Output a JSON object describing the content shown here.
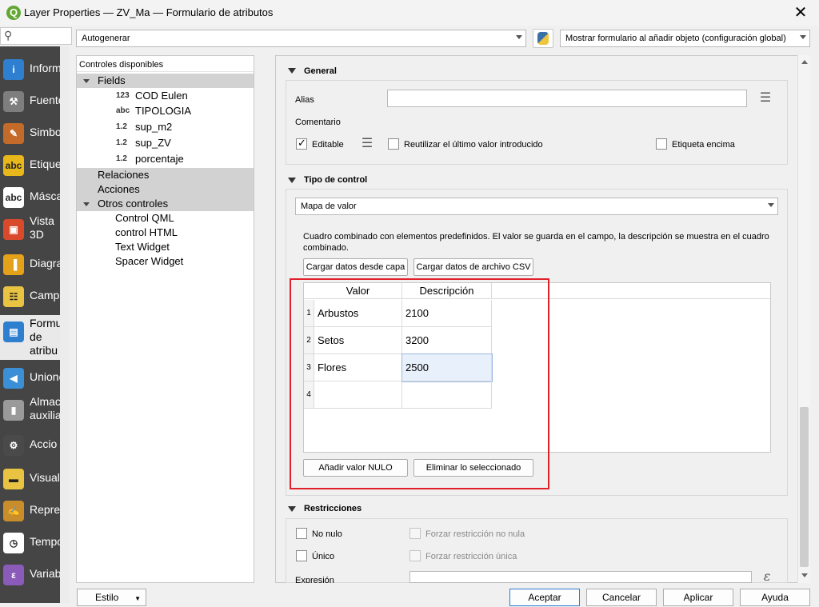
{
  "window": {
    "app_icon": "Q",
    "title": "Layer Properties — ZV_Ma — Formulario de atributos",
    "close_glyph": "✕"
  },
  "search": {
    "placeholder": ""
  },
  "sidebar": {
    "items": [
      {
        "label": "Inform",
        "icon": "info-icon",
        "color": "#2f7fd0",
        "glyph": "i"
      },
      {
        "label": "Fuente",
        "icon": "tools-icon",
        "color": "#7e7e7e",
        "glyph": "⚒"
      },
      {
        "label": "Simbo",
        "icon": "paint-icon",
        "color": "#c46b2a",
        "glyph": "✎"
      },
      {
        "label": "Etique",
        "icon": "abc-label-icon",
        "color": "#e8b71c",
        "glyph": "abc"
      },
      {
        "label": "Másca",
        "icon": "abc-mask-icon",
        "color": "#ffffff",
        "glyph": "abc"
      },
      {
        "label": "Vista 3D",
        "icon": "cube-3d-icon",
        "color": "#d94a2c",
        "glyph": "▣"
      },
      {
        "label": "Diagra",
        "icon": "diagram-icon",
        "color": "#e4a21a",
        "glyph": "▐"
      },
      {
        "label": "Campo",
        "icon": "fields-icon",
        "color": "#e9c342",
        "glyph": "☷"
      },
      {
        "label": "Formu de atribu",
        "icon": "form-icon",
        "color": "#2f7fd0",
        "glyph": "▤"
      },
      {
        "label": "Unione",
        "icon": "join-icon",
        "color": "#3b8fd6",
        "glyph": "◀"
      },
      {
        "label": "Almac auxilia",
        "icon": "database-icon",
        "color": "#9a9a9a",
        "glyph": "▮"
      },
      {
        "label": "Accio",
        "icon": "action-gear-icon",
        "color": "#4a4a4a",
        "glyph": "⚙"
      },
      {
        "label": "Visuali",
        "icon": "tooltip-icon",
        "color": "#e9c342",
        "glyph": "▬"
      },
      {
        "label": "Repres",
        "icon": "brush-icon",
        "color": "#c98d2b",
        "glyph": "✍"
      },
      {
        "label": "Tempo",
        "icon": "clock-icon",
        "color": "#ffffff",
        "glyph": "◷"
      },
      {
        "label": "Variab",
        "icon": "epsilon-icon",
        "color": "#8a5bb8",
        "glyph": "ε"
      }
    ]
  },
  "toolbar": {
    "layout_mode": "Autogenerar",
    "show_form_option": "Mostrar formulario al añadir objeto (configuración global)"
  },
  "controls_panel": {
    "header": "Controles disponibles",
    "tree": [
      {
        "label": "Fields",
        "kind": "group",
        "expanded": true
      },
      {
        "label": "COD Eulen",
        "type": "123",
        "kind": "field"
      },
      {
        "label": "TIPOLOGIA",
        "type": "abc",
        "kind": "field"
      },
      {
        "label": "sup_m2",
        "type": "1.2",
        "kind": "field"
      },
      {
        "label": "sup_ZV",
        "type": "1.2",
        "kind": "field"
      },
      {
        "label": "porcentaje",
        "type": "1.2",
        "kind": "field"
      },
      {
        "label": "Relaciones",
        "kind": "group"
      },
      {
        "label": "Acciones",
        "kind": "group"
      },
      {
        "label": "Otros controles",
        "kind": "group",
        "expanded": true
      },
      {
        "label": "Control QML",
        "kind": "child"
      },
      {
        "label": "control HTML",
        "kind": "child"
      },
      {
        "label": "Text Widget",
        "kind": "child"
      },
      {
        "label": "Spacer Widget",
        "kind": "child"
      }
    ]
  },
  "general": {
    "title": "General",
    "alias_label": "Alias",
    "alias_value": "",
    "comment_label": "Comentario",
    "editable_label": "Editable",
    "editable_checked": true,
    "reuse_label": "Reutilizar el último valor introducido",
    "reuse_checked": false,
    "label_on_top": "Etiqueta encima",
    "label_on_top_checked": false
  },
  "widget_type": {
    "title": "Tipo de control",
    "selected": "Mapa de valor",
    "description": "Cuadro combinado con elementos predefinidos. El valor se guarda en el campo, la descripción se muestra en el cuadro combinado.",
    "load_layer_button": "Cargar datos desde capa",
    "load_csv_button": "Cargar datos de archivo CSV",
    "table": {
      "columns": [
        "Valor",
        "Descripción"
      ],
      "rows": [
        {
          "num": "1",
          "valor": "Arbustos",
          "descripcion": "2100"
        },
        {
          "num": "2",
          "valor": "Setos",
          "descripcion": "3200"
        },
        {
          "num": "3",
          "valor": "Flores",
          "descripcion": "2500"
        },
        {
          "num": "4",
          "valor": "",
          "descripcion": ""
        }
      ]
    },
    "add_null_button": "Añadir valor NULO",
    "delete_selected_button": "Eliminar lo seleccionado"
  },
  "constraints": {
    "title": "Restricciones",
    "not_null_label": "No nulo",
    "enforce_not_null_label": "Forzar restricción no nula",
    "unique_label": "Único",
    "enforce_unique_label": "Forzar restricción única",
    "expression_label": "Expresión",
    "expression_value": ""
  },
  "footer": {
    "style_button": "Estilo",
    "accept_button": "Aceptar",
    "cancel_button": "Cancelar",
    "apply_button": "Aplicar",
    "help_button": "Ayuda"
  },
  "colors": {
    "highlight_box": "#e0202a",
    "sidebar_bg": "#454545",
    "group_bg": "#d2d2d2"
  }
}
